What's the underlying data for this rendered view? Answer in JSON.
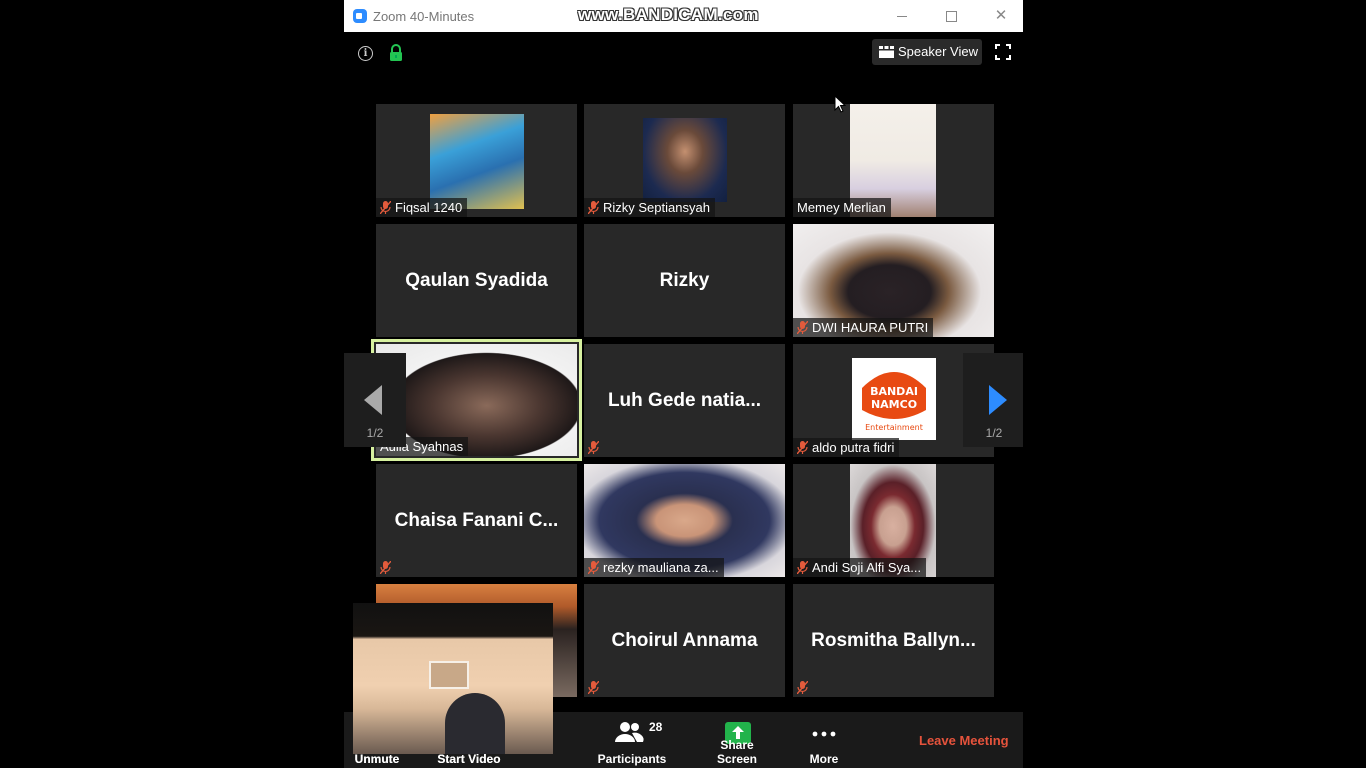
{
  "window": {
    "title": "Zoom 40-Minutes",
    "watermark": "www.BANDICAM.com"
  },
  "toolbar_top": {
    "speaker_view_label": "Speaker View"
  },
  "tiles": [
    {
      "name": "Fiqsal 1240",
      "type": "video",
      "muted": true
    },
    {
      "name": "Rizky Septiansyah",
      "type": "video",
      "muted": true
    },
    {
      "name": "Memey Merlian",
      "type": "video",
      "muted": false
    },
    {
      "name": "Qaulan Syadida",
      "type": "name",
      "muted": false
    },
    {
      "name": "Rizky",
      "type": "name",
      "muted": false
    },
    {
      "name": "DWI HAURA PUTRI",
      "type": "video",
      "muted": true
    },
    {
      "name": "Aulia Syahnas",
      "type": "video",
      "muted": false,
      "active_speaker": true
    },
    {
      "name": "Luh Gede natia...",
      "type": "name",
      "muted": true
    },
    {
      "name": "aldo putra fidri",
      "type": "video",
      "muted": true,
      "logo_text": [
        "BANDAI",
        "NAMCO",
        "Entertainment"
      ]
    },
    {
      "name": "Chaisa Fanani C...",
      "type": "name",
      "muted": true
    },
    {
      "name": "rezky mauliana za...",
      "type": "video",
      "muted": true
    },
    {
      "name": "Andi Soji Alfi Sya...",
      "type": "video",
      "muted": true
    },
    {
      "name": "",
      "type": "video",
      "muted": false
    },
    {
      "name": "Choirul Annama",
      "type": "name",
      "muted": true
    },
    {
      "name": "Rosmitha  Ballyn...",
      "type": "name",
      "muted": true
    }
  ],
  "pagination": {
    "left_label": "1/2",
    "right_label": "1/2"
  },
  "bottombar": {
    "unmute_label": "Unmute",
    "start_video_label": "Start Video",
    "participants_label": "Participants",
    "participants_count": "28",
    "share_screen_label": "Share Screen",
    "more_label": "More",
    "leave_label": "Leave Meeting"
  },
  "colors": {
    "accent_blue": "#2d8cff",
    "share_green": "#22b34b",
    "leave_red": "#e6533c",
    "active_outline": "#d7f1a0",
    "mute_red": "#e35b3c"
  }
}
